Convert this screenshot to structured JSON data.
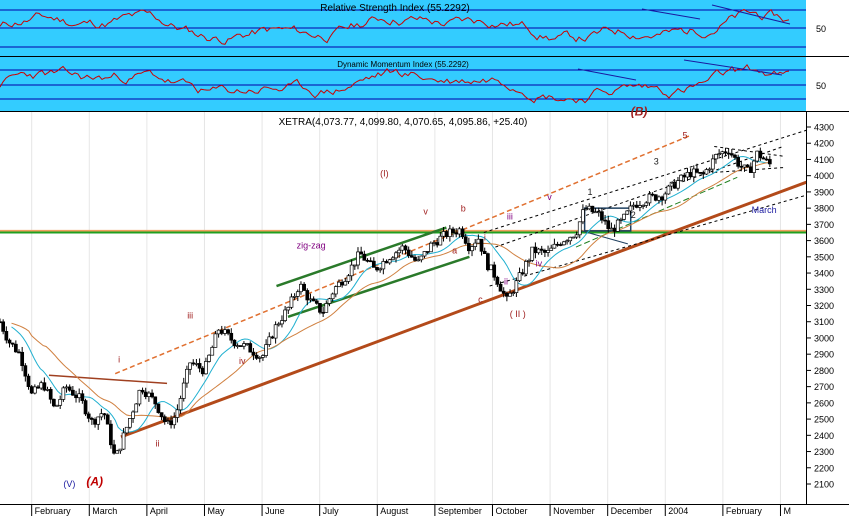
{
  "chart_data": {
    "type": "candlestick",
    "title": "XETRA(4,073.77, 4,099.80, 4,070.65, 4,095.86, +25.40)",
    "symbol": "XETRA",
    "last_bar": {
      "open": "4,073.77",
      "high": "4,099.80",
      "low": "4,070.65",
      "close": "4,095.86",
      "change": "+25.40"
    },
    "x_ticks": [
      "February",
      "March",
      "April",
      "May",
      "June",
      "July",
      "August",
      "September",
      "October",
      "November",
      "December",
      "2004",
      "February",
      "M"
    ],
    "ylim": [
      2100,
      4300
    ],
    "y_ticks": [
      4300,
      4200,
      4100,
      4000,
      3900,
      3800,
      3700,
      3600,
      3500,
      3400,
      3300,
      3200,
      3100,
      3000,
      2900,
      2800,
      2700,
      2600,
      2500,
      2400,
      2300,
      2200,
      2100
    ],
    "price_points": [
      {
        "month": 0.0,
        "price": 3100
      },
      {
        "month": 0.15,
        "price": 2980
      },
      {
        "month": 0.35,
        "price": 2900
      },
      {
        "month": 0.55,
        "price": 2650
      },
      {
        "month": 0.75,
        "price": 2720
      },
      {
        "month": 0.95,
        "price": 2560
      },
      {
        "month": 1.15,
        "price": 2700
      },
      {
        "month": 1.4,
        "price": 2620
      },
      {
        "month": 1.6,
        "price": 2480
      },
      {
        "month": 1.8,
        "price": 2550
      },
      {
        "month": 2.0,
        "price": 2250
      },
      {
        "month": 2.2,
        "price": 2450
      },
      {
        "month": 2.45,
        "price": 2700
      },
      {
        "month": 2.7,
        "price": 2600
      },
      {
        "month": 2.9,
        "price": 2460
      },
      {
        "month": 3.05,
        "price": 2520
      },
      {
        "month": 3.3,
        "price": 2850
      },
      {
        "month": 3.55,
        "price": 2800
      },
      {
        "month": 3.8,
        "price": 3060
      },
      {
        "month": 4.05,
        "price": 2980
      },
      {
        "month": 4.3,
        "price": 2940
      },
      {
        "month": 4.55,
        "price": 2880
      },
      {
        "month": 4.8,
        "price": 3080
      },
      {
        "month": 5.0,
        "price": 3180
      },
      {
        "month": 5.2,
        "price": 3330
      },
      {
        "month": 5.4,
        "price": 3220
      },
      {
        "month": 5.6,
        "price": 3160
      },
      {
        "month": 5.8,
        "price": 3300
      },
      {
        "month": 6.0,
        "price": 3380
      },
      {
        "month": 6.25,
        "price": 3520
      },
      {
        "month": 6.5,
        "price": 3420
      },
      {
        "month": 6.75,
        "price": 3500
      },
      {
        "month": 7.0,
        "price": 3560
      },
      {
        "month": 7.25,
        "price": 3460
      },
      {
        "month": 7.5,
        "price": 3580
      },
      {
        "month": 7.75,
        "price": 3640
      },
      {
        "month": 8.0,
        "price": 3670
      },
      {
        "month": 8.15,
        "price": 3560
      },
      {
        "month": 8.3,
        "price": 3620
      },
      {
        "month": 8.45,
        "price": 3460
      },
      {
        "month": 8.6,
        "price": 3380
      },
      {
        "month": 8.8,
        "price": 3230
      },
      {
        "month": 9.0,
        "price": 3360
      },
      {
        "month": 9.25,
        "price": 3540
      },
      {
        "month": 9.5,
        "price": 3520
      },
      {
        "month": 9.75,
        "price": 3600
      },
      {
        "month": 10.0,
        "price": 3650
      },
      {
        "month": 10.15,
        "price": 3800
      },
      {
        "month": 10.4,
        "price": 3760
      },
      {
        "month": 10.6,
        "price": 3660
      },
      {
        "month": 10.8,
        "price": 3720
      },
      {
        "month": 11.0,
        "price": 3820
      },
      {
        "month": 11.25,
        "price": 3860
      },
      {
        "month": 11.5,
        "price": 3880
      },
      {
        "month": 11.75,
        "price": 3960
      },
      {
        "month": 12.0,
        "price": 4020
      },
      {
        "month": 12.2,
        "price": 4000
      },
      {
        "month": 12.45,
        "price": 4130
      },
      {
        "month": 12.65,
        "price": 4160
      },
      {
        "month": 12.85,
        "price": 4060
      },
      {
        "month": 13.0,
        "price": 4020
      },
      {
        "month": 13.15,
        "price": 4140
      },
      {
        "month": 13.35,
        "price": 4070
      }
    ],
    "trendlines": [
      {
        "name": "long-support",
        "color": "#b34a1a",
        "from": {
          "month": 2.1,
          "price": 2390
        },
        "to": {
          "month": 14.0,
          "price": 3960
        }
      },
      {
        "name": "upper-dashed-channel",
        "color": "#e07030",
        "from": {
          "month": 2.0,
          "price": 2780
        },
        "to": {
          "month": 12.0,
          "price": 4250
        }
      },
      {
        "name": "zig-zag-upper",
        "color": "#2a7a2a",
        "from": {
          "month": 4.8,
          "price": 3320
        },
        "to": {
          "month": 7.75,
          "price": 3680
        }
      },
      {
        "name": "zig-zag-lower",
        "color": "#2a7a2a",
        "from": {
          "month": 5.0,
          "price": 3130
        },
        "to": {
          "month": 8.15,
          "price": 3500
        }
      },
      {
        "name": "march-resistance",
        "color": "#a04020",
        "from": {
          "month": 0.85,
          "price": 2770
        },
        "to": {
          "month": 2.9,
          "price": 2720
        }
      }
    ],
    "horizontal_levels": [
      {
        "price": 3660,
        "color": "#f0a060"
      },
      {
        "price": 3650,
        "color": "#20a020"
      }
    ],
    "annotations": [
      {
        "text": "(I)",
        "month": 6.6,
        "price": 3995,
        "color": "#a02020"
      },
      {
        "text": "( II )",
        "month": 8.85,
        "price": 3130,
        "color": "#a02020"
      },
      {
        "text": "zig-zag",
        "month": 5.15,
        "price": 3550,
        "color": "#800080"
      },
      {
        "text": "v",
        "month": 7.35,
        "price": 3760,
        "color": "#a02020"
      },
      {
        "text": "iii",
        "month": 3.25,
        "price": 3120,
        "color": "#a02020"
      },
      {
        "text": "iv",
        "month": 4.15,
        "price": 2840,
        "color": "#a02020"
      },
      {
        "text": "i",
        "month": 2.05,
        "price": 2850,
        "color": "#a02020"
      },
      {
        "text": "ii",
        "month": 2.7,
        "price": 2330,
        "color": "#a02020"
      },
      {
        "text": "a",
        "month": 7.85,
        "price": 3520,
        "color": "#a02020"
      },
      {
        "text": "b",
        "month": 8.0,
        "price": 3780,
        "color": "#a02020"
      },
      {
        "text": "c",
        "month": 8.3,
        "price": 3220,
        "color": "#a02020"
      },
      {
        "text": "i",
        "month": 8.4,
        "price": 3600,
        "color": "#a02020"
      },
      {
        "text": "iii",
        "month": 8.8,
        "price": 3730,
        "color": "#800080"
      },
      {
        "text": "ii",
        "month": 8.75,
        "price": 3330,
        "color": "#800080"
      },
      {
        "text": "iv",
        "month": 9.3,
        "price": 3440,
        "color": "#800080"
      },
      {
        "text": "v",
        "month": 9.5,
        "price": 3850,
        "color": "#800080"
      },
      {
        "text": "1",
        "month": 10.2,
        "price": 3880,
        "color": "#202020"
      },
      {
        "text": "2",
        "month": 10.95,
        "price": 3740,
        "color": "#202020"
      },
      {
        "text": "3",
        "month": 11.35,
        "price": 4070,
        "color": "#202020"
      },
      {
        "text": "4",
        "month": 11.65,
        "price": 3940,
        "color": "#202020"
      },
      {
        "text": "5",
        "month": 11.85,
        "price": 4230,
        "color": "#a02020"
      },
      {
        "text": "(A)",
        "month": 1.5,
        "price": 2090,
        "color": "#c00000"
      },
      {
        "text": "(V)",
        "month": 1.1,
        "price": 2080,
        "color": "#1a1aa0"
      },
      {
        "text": "(B)",
        "month": 10.95,
        "price": 4370,
        "color": "#a02020"
      },
      {
        "text": "March",
        "month": 13.05,
        "price": 3770,
        "color": "#1a1aa0"
      }
    ],
    "grid": true
  },
  "panels": {
    "rsi": {
      "title": "Relative Strength Index (55.2292)",
      "level_label": "50",
      "background": "#33ccff",
      "line_color": "#cc0000"
    },
    "dmi": {
      "title": "Dynamic Momentum Index (55.2292)",
      "level_label": "50",
      "background": "#33ccff",
      "line_color": "#cc0000"
    }
  }
}
